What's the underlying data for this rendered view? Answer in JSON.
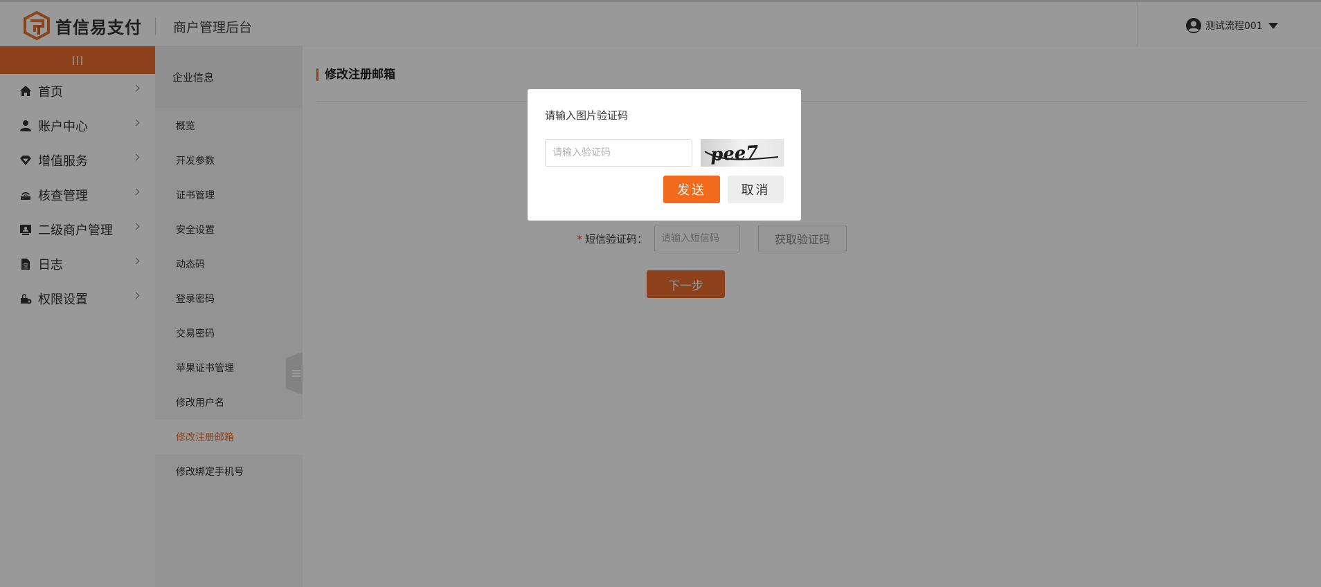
{
  "header": {
    "logo_text": "首信易支付",
    "subtitle": "商户管理后台",
    "user_name": "测试流程001"
  },
  "sidebar": {
    "items": [
      {
        "label": "首页",
        "icon": "home-icon"
      },
      {
        "label": "账户中心",
        "icon": "user-icon"
      },
      {
        "label": "增值服务",
        "icon": "diamond-icon"
      },
      {
        "label": "核查管理",
        "icon": "router-icon"
      },
      {
        "label": "二级商户管理",
        "icon": "id-card-icon"
      },
      {
        "label": "日志",
        "icon": "document-icon"
      },
      {
        "label": "权限设置",
        "icon": "lock-settings-icon"
      }
    ]
  },
  "subnav": {
    "heading": "企业信息",
    "items": [
      "概览",
      "开发参数",
      "证书管理",
      "安全设置",
      "动态码",
      "登录密码",
      "交易密码",
      "苹果证书管理",
      "修改用户名",
      "修改注册邮箱",
      "修改绑定手机号"
    ],
    "active_index": 9
  },
  "main": {
    "title": "修改注册邮箱",
    "sms_label": "短信验证码：",
    "sms_required_mark": "*",
    "sms_placeholder": "请输入短信码",
    "get_code_label": "获取验证码",
    "next_label": "下一步"
  },
  "modal": {
    "title": "请输入图片验证码",
    "input_placeholder": "请输入验证码",
    "captcha_text": "pee7",
    "send_label": "发送",
    "cancel_label": "取消"
  },
  "colors": {
    "accent": "#ec6d2d",
    "send_button": "#f26b1d",
    "overlay": "rgba(0,0,0,0.40)"
  }
}
